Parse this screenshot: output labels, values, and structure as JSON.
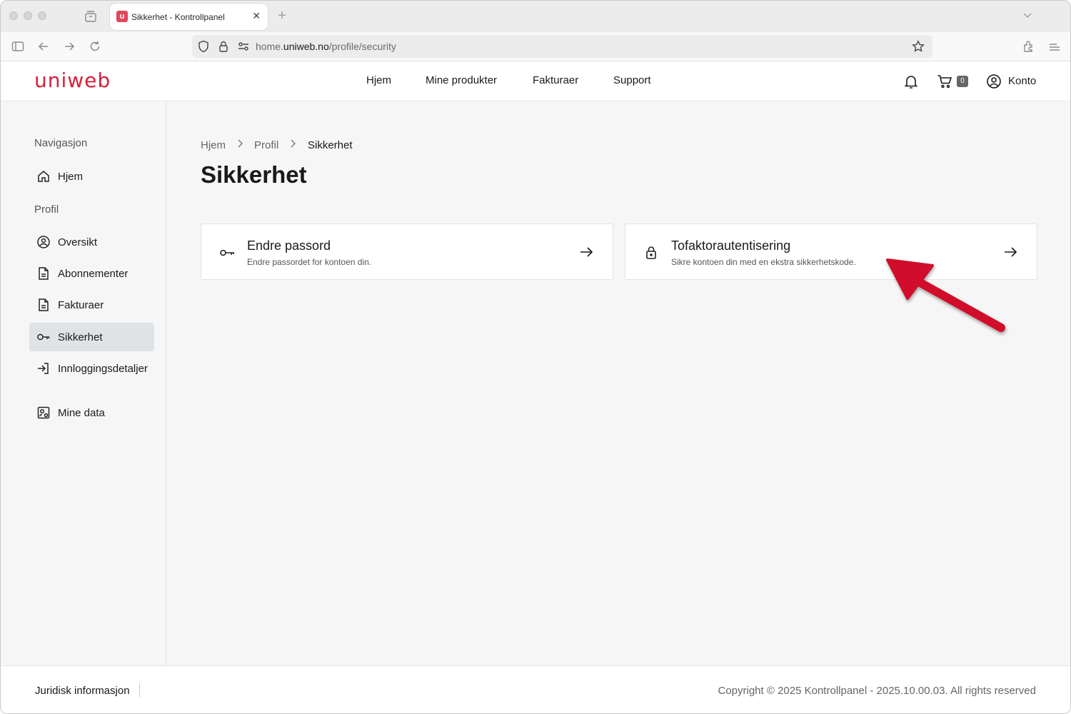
{
  "browser": {
    "tab_title": "Sikkerhet - Kontrollpanel",
    "tab_favicon": "u",
    "url_prefix": "home.",
    "url_domain": "uniweb.no",
    "url_path": "/profile/security"
  },
  "header": {
    "logo": "uniweb",
    "nav": [
      "Hjem",
      "Mine produkter",
      "Fakturaer",
      "Support"
    ],
    "cart_count": "0",
    "account_label": "Konto"
  },
  "sidebar": {
    "heading_nav": "Navigasjon",
    "home": "Hjem",
    "heading_profile": "Profil",
    "items": [
      {
        "label": "Oversikt",
        "icon": "user-circle-icon"
      },
      {
        "label": "Abonnementer",
        "icon": "document-icon"
      },
      {
        "label": "Fakturaer",
        "icon": "document-icon"
      },
      {
        "label": "Sikkerhet",
        "icon": "key-icon",
        "active": true
      },
      {
        "label": "Innloggingsdetaljer",
        "icon": "login-icon"
      },
      {
        "label": "Mine data",
        "icon": "user-settings-icon"
      }
    ]
  },
  "main": {
    "breadcrumb": [
      "Hjem",
      "Profil",
      "Sikkerhet"
    ],
    "title": "Sikkerhet",
    "cards": [
      {
        "title": "Endre passord",
        "desc": "Endre passordet for kontoen din.",
        "icon": "key-icon"
      },
      {
        "title": "Tofaktorautentisering",
        "desc": "Sikre kontoen din med en ekstra sikkerhetskode.",
        "icon": "lock-icon"
      }
    ]
  },
  "footer": {
    "legal": "Juridisk informasjon",
    "copyright": "Copyright © 2025 Kontrollpanel - 2025.10.00.03. All rights reserved"
  },
  "colors": {
    "brand": "#d6203b",
    "annotation_arrow": "#d0102a"
  }
}
